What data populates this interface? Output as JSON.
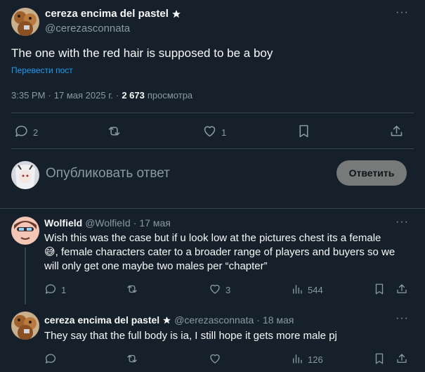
{
  "main_post": {
    "author_name": "cereza encima del pastel",
    "handle": "@cerezasconnata",
    "text": "The one with the red hair is supposed to be a boy",
    "translate_label": "Перевести пост",
    "time": "3:35 PM",
    "dot": "·",
    "date": "17 мая 2025 г.",
    "views_count": "2 673",
    "views_label": "просмотра",
    "actions": {
      "replies": "2",
      "reposts": "",
      "likes": "1"
    }
  },
  "composer": {
    "placeholder": "Опубликовать ответ",
    "reply_button": "Ответить"
  },
  "replies": [
    {
      "author_name": "Wolfield",
      "handle": "@WolfieId",
      "dot": "·",
      "date": "17 мая",
      "text_line1": "Wish this was the case but if u look low at the pictures chest its a female",
      "emoji": "😅",
      "text_line2": ", female characters cater to a broader range of players and buyers so we",
      "text_line3": "will only get one maybe two males per “chapter”",
      "actions": {
        "replies": "1",
        "reposts": "",
        "likes": "3",
        "views": "544"
      }
    },
    {
      "author_name": "cereza encima del pastel",
      "handle": "@cerezasconnata",
      "dot": "·",
      "date": "18 мая",
      "text": "They say that the full body is ia, I still hope it gets more male pj",
      "actions": {
        "replies": "",
        "reposts": "",
        "likes": "",
        "views": "126"
      }
    }
  ],
  "colors": {
    "background": "#15202b",
    "divider": "#38444d",
    "muted": "#8b98a5",
    "link": "#1d9bf0",
    "reply_button_bg": "#787a7a"
  }
}
